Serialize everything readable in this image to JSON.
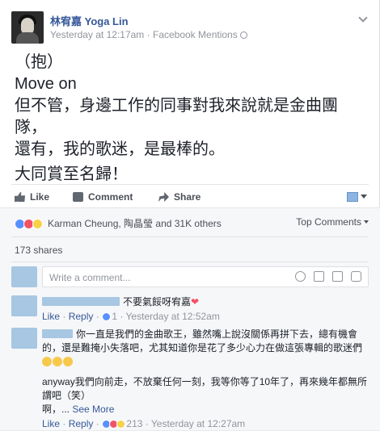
{
  "post": {
    "author": "林宥嘉  Yoga Lin",
    "timestamp": "Yesterday at 12:17am",
    "source": "Facebook Mentions",
    "separator": " · ",
    "lines": [
      "（抱）",
      "Move on",
      "但不管，身邊工作的同事對我來說就是金曲團隊，",
      "還有，我的歌迷，是最棒的。",
      "大同賞至名歸！"
    ]
  },
  "actions": {
    "like": "Like",
    "comment": "Comment",
    "share": "Share"
  },
  "reactions": {
    "summary": "Karman Cheung, 陶晶瑩 and 31K others",
    "top_comments": "Top Comments",
    "shares": "173 shares",
    "colors": {
      "like": "#5890ff",
      "love": "#f25268",
      "sad": "#f7d14a"
    }
  },
  "composer": {
    "placeholder": "Write a comment..."
  },
  "comments": [
    {
      "text": "不要氣餒呀宥嘉",
      "heart": "❤",
      "like_label": "Like",
      "reply_label": "Reply",
      "reaction_count": "1",
      "time": "Yesterday at 12:52am"
    },
    {
      "paragraph1": "你一直是我們的金曲歌王，雖然嘴上說沒關係再拼下去，總有機會的，還是難掩小失落吧，尤其知道你是花了多少心力在做這張專輯的歌迷們",
      "paragraph2": "anyway我們向前走，不放棄任何一刻，我等你等了10年了，再來幾年都無所謂吧（笑）",
      "paragraph3": "啊，...",
      "see_more": "See More",
      "like_label": "Like",
      "reply_label": "Reply",
      "reaction_count": "213",
      "time": "Yesterday at 12:27am"
    }
  ],
  "colors": {
    "link": "#365899",
    "muted": "#90949c",
    "text": "#1d2129"
  }
}
